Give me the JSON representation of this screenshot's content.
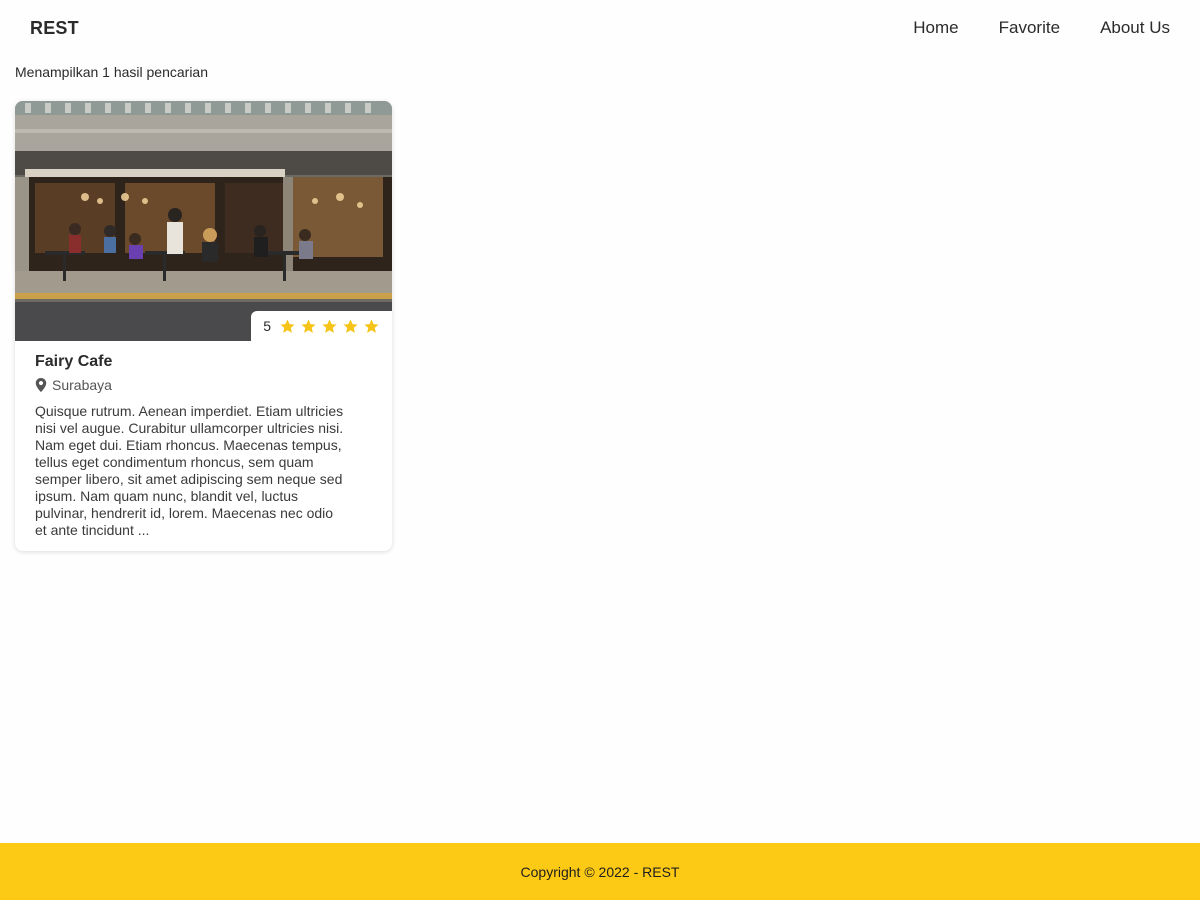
{
  "header": {
    "brand": "REST",
    "nav": [
      "Home",
      "Favorite",
      "About Us"
    ]
  },
  "search": {
    "result_text": "Menampilkan 1 hasil pencarian"
  },
  "restaurants": [
    {
      "name": "Fairy Cafe",
      "city": "Surabaya",
      "rating": "5",
      "stars": 5,
      "image_icon": "restaurant-photo",
      "description": "Quisque rutrum. Aenean imperdiet. Etiam ultricies nisi vel augue. Curabitur ullamcorper ultricies nisi. Nam eget dui. Etiam rhoncus. Maecenas tempus, tellus eget condimentum rhoncus, sem quam semper libero, sit amet adipiscing sem neque sed ipsum. Nam quam nunc, blandit vel, luctus pulvinar, hendrerit id, lorem. Maecenas nec odio et ante tincidunt ..."
    }
  ],
  "footer": {
    "copyright": "Copyright © 2022 - REST"
  },
  "colors": {
    "accent": "#fcc914",
    "star": "#f6c419",
    "text": "#2b2b2b"
  },
  "icons": {
    "location": "map-pin-icon",
    "star": "star-icon"
  }
}
